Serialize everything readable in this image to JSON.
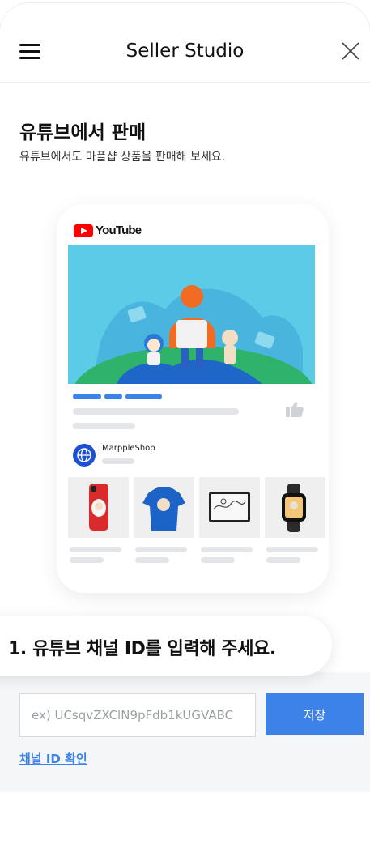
{
  "header": {
    "title": "Seller Studio"
  },
  "page": {
    "title": "유튜브에서 판매",
    "subtitle": "유튜브에서도 마플샵 상품을 판매해 보세요."
  },
  "preview": {
    "platform": "YouTube",
    "channel_name": "MarppleShop"
  },
  "step": {
    "label": "1. 유튜브 채널 ID를 입력해 주세요."
  },
  "form": {
    "channel_input_placeholder": "ex) UCsqvZXClN9pFdb1kUGVABC",
    "channel_input_value": "",
    "save_label": "저장",
    "verify_link": "채널 ID 확인"
  },
  "colors": {
    "accent": "#3d82e8",
    "youtube_red": "#ff0000",
    "banner": "#5bcbe8"
  }
}
